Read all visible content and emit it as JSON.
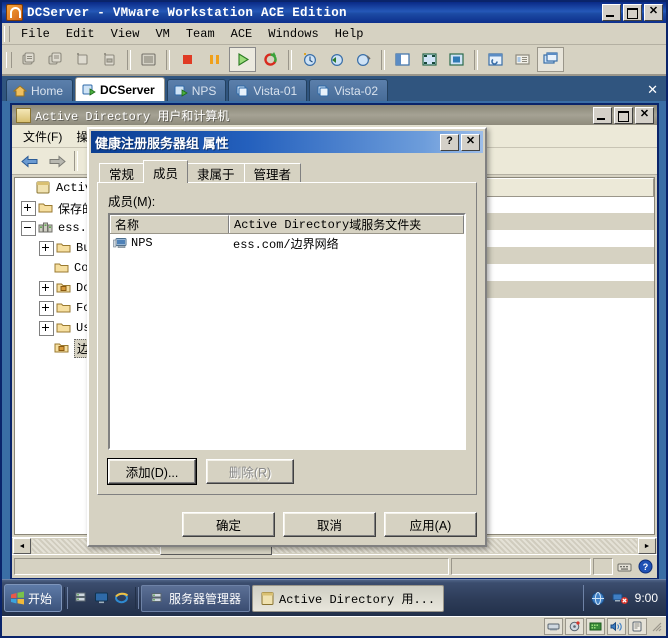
{
  "vmware": {
    "title": "DCServer - VMware Workstation ACE Edition",
    "icon": "vmware-logo-icon",
    "window_buttons": {
      "minimize": "_",
      "maximize": "□",
      "close": "✕"
    },
    "menu": [
      {
        "label": "File"
      },
      {
        "label": "Edit"
      },
      {
        "label": "View"
      },
      {
        "label": "VM"
      },
      {
        "label": "Team"
      },
      {
        "label": "ACE"
      },
      {
        "label": "Windows"
      },
      {
        "label": "Help"
      }
    ],
    "toolbar": [
      {
        "name": "new-virtual-machine-icon"
      },
      {
        "name": "new-team-icon"
      },
      {
        "name": "power-on-this-vm-icon"
      },
      {
        "name": "add-hardware-icon"
      },
      {
        "sep": true
      },
      {
        "name": "open-vm-icon"
      },
      {
        "sep": true
      },
      {
        "name": "power-off-icon"
      },
      {
        "name": "suspend-icon"
      },
      {
        "name": "power-on-play-icon"
      },
      {
        "name": "reset-icon"
      },
      {
        "sep": true
      },
      {
        "name": "snapshot-icon"
      },
      {
        "name": "revert-snapshot-icon"
      },
      {
        "name": "snapshot-manager-icon"
      },
      {
        "sep": true
      },
      {
        "name": "show-sidebar-icon"
      },
      {
        "name": "full-screen-icon"
      },
      {
        "name": "quick-switch-icon"
      },
      {
        "sep": true
      },
      {
        "name": "vm-settings-icon"
      },
      {
        "name": "summary-view-icon"
      },
      {
        "name": "console-view-icon"
      }
    ],
    "tabs": [
      {
        "label": "Home",
        "icon": "home-icon",
        "selected": false
      },
      {
        "label": "DCServer",
        "icon": "vm-running-icon",
        "selected": true
      },
      {
        "label": "NPS",
        "icon": "vm-running-icon",
        "selected": false
      },
      {
        "label": "Vista-01",
        "icon": "vm-icon",
        "selected": false
      },
      {
        "label": "Vista-02",
        "icon": "vm-icon",
        "selected": false
      }
    ],
    "tabs_close": "✕",
    "statusbar_icons": [
      "network-icon",
      "disk-icon",
      "cd-icon",
      "sound-icon",
      "usb-icon"
    ]
  },
  "mmc": {
    "title": "Active Directory 用户和计算机",
    "icon": "mmc-console-icon",
    "window_buttons": {
      "minimize": "_",
      "maximize": "□",
      "close": "✕"
    },
    "menu": [
      {
        "label": "文件(F)"
      },
      {
        "label": "操作"
      }
    ],
    "toolbar": [
      {
        "name": "back-arrow-icon"
      },
      {
        "name": "forward-arrow-icon"
      },
      {
        "name": "up-folder-icon"
      }
    ],
    "tree": [
      {
        "label": "Active Dir",
        "indent": 0,
        "expander": "none",
        "icon": "console-root-icon"
      },
      {
        "label": "保存的(",
        "indent": 0,
        "expander": "plus",
        "icon": "folder-icon"
      },
      {
        "label": "ess.co",
        "indent": 0,
        "expander": "minus",
        "icon": "domain-icon"
      },
      {
        "label": "Bui",
        "indent": 1,
        "expander": "plus",
        "icon": "folder-icon"
      },
      {
        "label": "Com",
        "indent": 1,
        "expander": "none",
        "icon": "folder-icon"
      },
      {
        "label": "Dom",
        "indent": 1,
        "expander": "plus",
        "icon": "ou-folder-icon"
      },
      {
        "label": "For",
        "indent": 1,
        "expander": "plus",
        "icon": "folder-icon"
      },
      {
        "label": "Use",
        "indent": 1,
        "expander": "plus",
        "icon": "folder-icon"
      },
      {
        "label": "边界",
        "indent": 1,
        "expander": "none",
        "icon": "ou-folder-icon",
        "selected": true
      }
    ],
    "list_columns": [
      {
        "label": "描述"
      }
    ],
    "status_text": ""
  },
  "dialog": {
    "title": "健康注册服务器组 属性",
    "help_button": "?",
    "close_button": "✕",
    "tabs": [
      {
        "label": "常规",
        "selected": false
      },
      {
        "label": "成员",
        "selected": true
      },
      {
        "label": "隶属于",
        "selected": false
      },
      {
        "label": "管理者",
        "selected": false
      }
    ],
    "members_label": "成员(M):",
    "columns": [
      {
        "label_en": "名称",
        "label_cn": ""
      },
      {
        "label_en": "Active Directory ",
        "label_cn": "域服务文件夹"
      }
    ],
    "rows": [
      {
        "icon": "computer-icon",
        "name": "NPS",
        "folder_en": "ess.com/",
        "folder_cn": "边界网络"
      }
    ],
    "add_button": "添加(D)...",
    "remove_button": "删除(R)",
    "ok_button": "确定",
    "cancel_button": "取消",
    "apply_button": "应用(A)"
  },
  "taskbar": {
    "start_label": "开始",
    "quick_launch": [
      {
        "name": "server-manager-quick-icon"
      },
      {
        "name": "show-desktop-icon"
      },
      {
        "name": "internet-explorer-icon"
      }
    ],
    "buttons": [
      {
        "label": "服务器管理器",
        "icon": "server-manager-icon",
        "active": false
      },
      {
        "label": "Active Directory 用...",
        "icon": "mmc-console-icon",
        "active": true
      }
    ],
    "tray": {
      "icons": [
        {
          "name": "network-icon"
        },
        {
          "name": "volume-muted-icon"
        }
      ],
      "clock": "9:00"
    }
  },
  "colors": {
    "vmware_title_blue": "#0a2a86",
    "dialog_title_blue": "#0a3d91",
    "chrome_gray": "#d6d2c2",
    "tabstrip_blue": "#30557f",
    "mmc_title_gray": "#8b8878"
  }
}
